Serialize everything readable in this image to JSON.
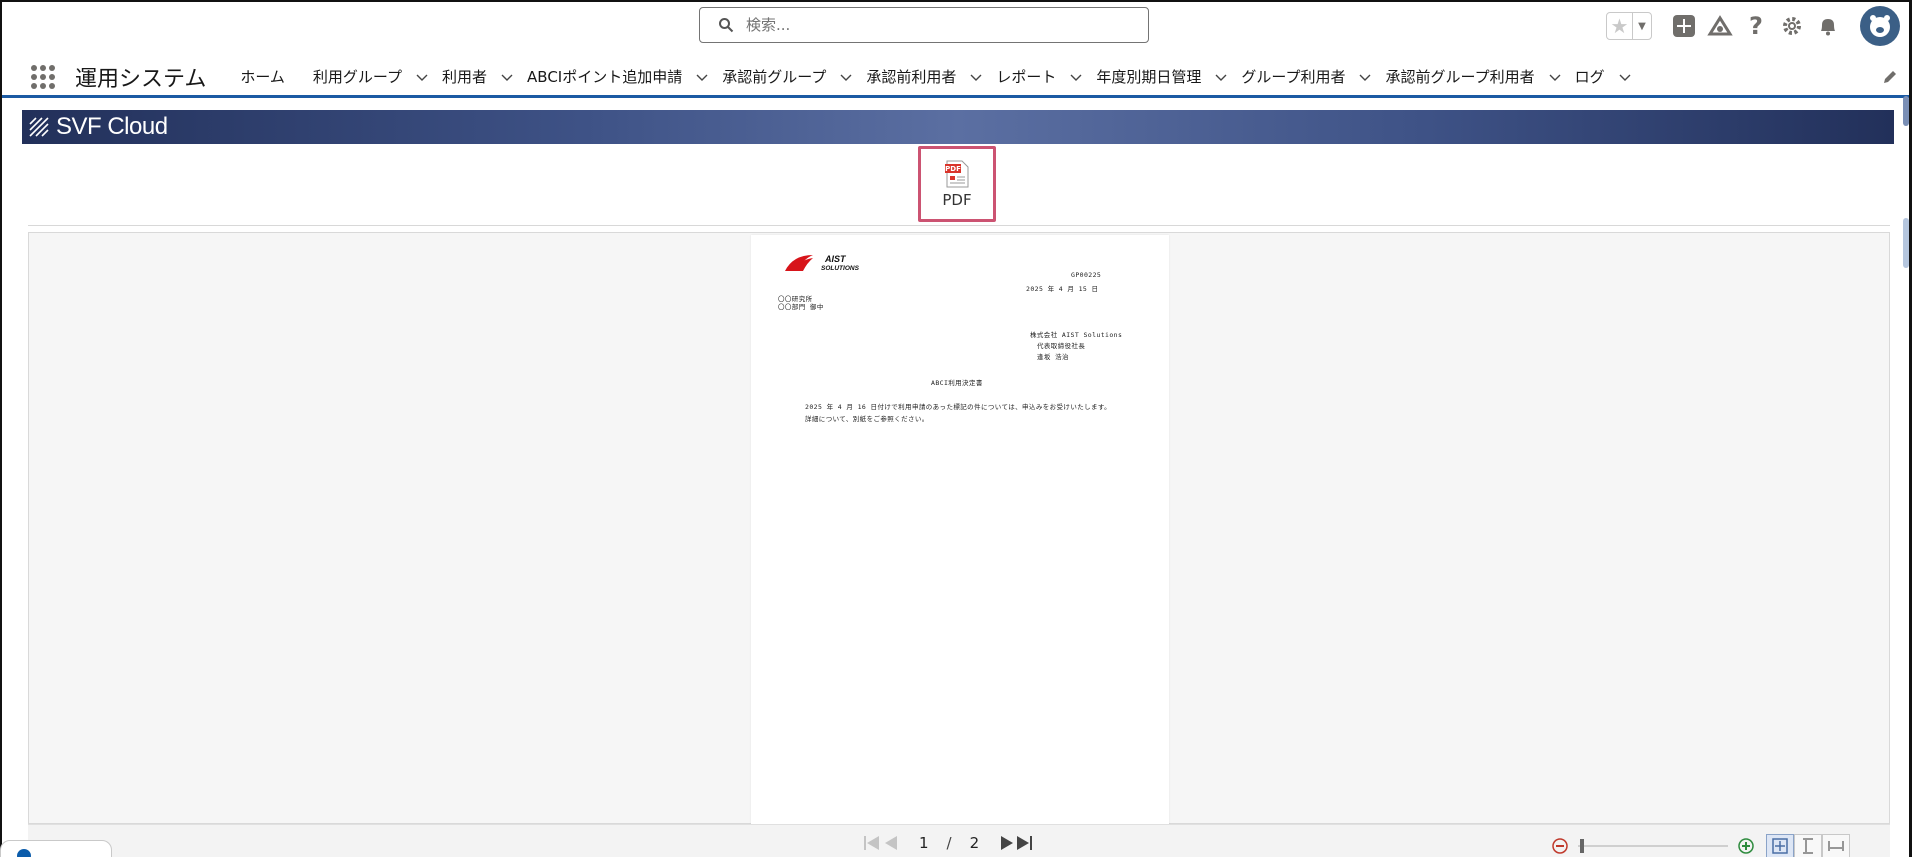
{
  "search": {
    "placeholder": "検索..."
  },
  "header_icons": [
    "star-icon",
    "add-icon",
    "trailhead-icon",
    "help-icon",
    "setup-gear-icon",
    "notifications-bell-icon",
    "user-avatar"
  ],
  "app": {
    "name": "運用システム"
  },
  "nav": {
    "tabs": [
      {
        "label": "ホーム",
        "has_menu": false
      },
      {
        "label": "利用グループ",
        "has_menu": true
      },
      {
        "label": "利用者",
        "has_menu": true
      },
      {
        "label": "ABCIポイント追加申請",
        "has_menu": true
      },
      {
        "label": "承認前グループ",
        "has_menu": true
      },
      {
        "label": "承認前利用者",
        "has_menu": true
      },
      {
        "label": "レポート",
        "has_menu": true
      },
      {
        "label": "年度別期日管理",
        "has_menu": true
      },
      {
        "label": "グループ利用者",
        "has_menu": true
      },
      {
        "label": "承認前グループ利用者",
        "has_menu": true
      },
      {
        "label": "ログ",
        "has_menu": true
      }
    ]
  },
  "svf": {
    "title": "SVF Cloud",
    "pdf_button_label": "PDF"
  },
  "document": {
    "logo_line1": "AIST",
    "logo_line2": "SOLUTIONS",
    "doc_code": "GP00225",
    "date": "2025 年  4 月  15 日",
    "recipient_line1": "〇〇研究所",
    "recipient_line2": "〇〇部門 御中",
    "sender_company": "株式会社 AIST Solutions",
    "sender_title": "代表取締役社長",
    "sender_name": "逢坂 浩治",
    "doc_title": "ABCI利用決定書",
    "body_line1": "2025  年   4  月  16 日付けで利用申請のあった標記の件については、申込みをお受けいたします。",
    "body_line2": "詳細について、別紙をご参照ください。"
  },
  "pager": {
    "current": "1",
    "separator": "/",
    "total": "2"
  },
  "colors": {
    "nav_underline": "#1b5aa3",
    "pdf_highlight": "#cc5372",
    "banner": "#3e5286",
    "avatar": "#3b5f86"
  }
}
